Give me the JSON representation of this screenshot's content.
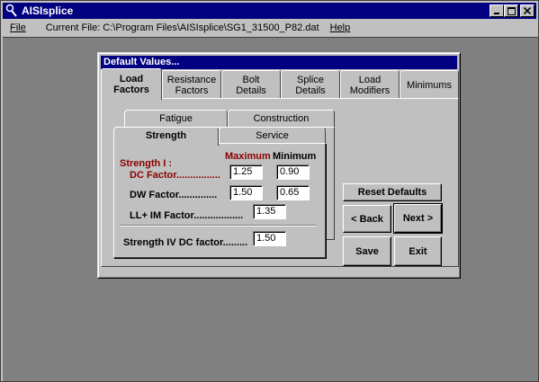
{
  "app": {
    "title": "AISIsplice",
    "window_buttons": {
      "minimize": "_",
      "maximize": "□",
      "close": "✕"
    }
  },
  "menu": {
    "file": "File",
    "current_file": "Current File:  C:\\Program Files\\AISIsplice\\SG1_31500_P82.dat",
    "help": "Help"
  },
  "dialog": {
    "title": "Default Values...",
    "tabs": [
      {
        "line1": "Load",
        "line2": "Factors"
      },
      {
        "line1": "Resistance",
        "line2": "Factors"
      },
      {
        "line1": "Bolt",
        "line2": "Details"
      },
      {
        "line1": "Splice",
        "line2": "Details"
      },
      {
        "line1": "Load",
        "line2": "Modifiers"
      },
      {
        "line1": "Minimums",
        "line2": ""
      }
    ],
    "inner_tabs": {
      "fatigue": "Fatigue",
      "construction": "Construction",
      "strength": "Strength",
      "service": "Service"
    },
    "form": {
      "maximum_label": "Maximum",
      "minimum_label": "Minimum",
      "strength1_label": "Strength I :",
      "dc_label": "DC Factor................",
      "dc_max": "1.25",
      "dc_min": "0.90",
      "dw_label": "DW Factor..............",
      "dw_max": "1.50",
      "dw_min": "0.65",
      "llim_label": "LL+ IM Factor..................",
      "llim_value": "1.35",
      "strength4_label": "Strength IV DC factor.........",
      "strength4_value": "1.50"
    },
    "buttons": {
      "reset_defaults": "Reset Defaults",
      "back": "< Back",
      "next": "Next >",
      "save": "Save",
      "exit": "Exit"
    }
  }
}
